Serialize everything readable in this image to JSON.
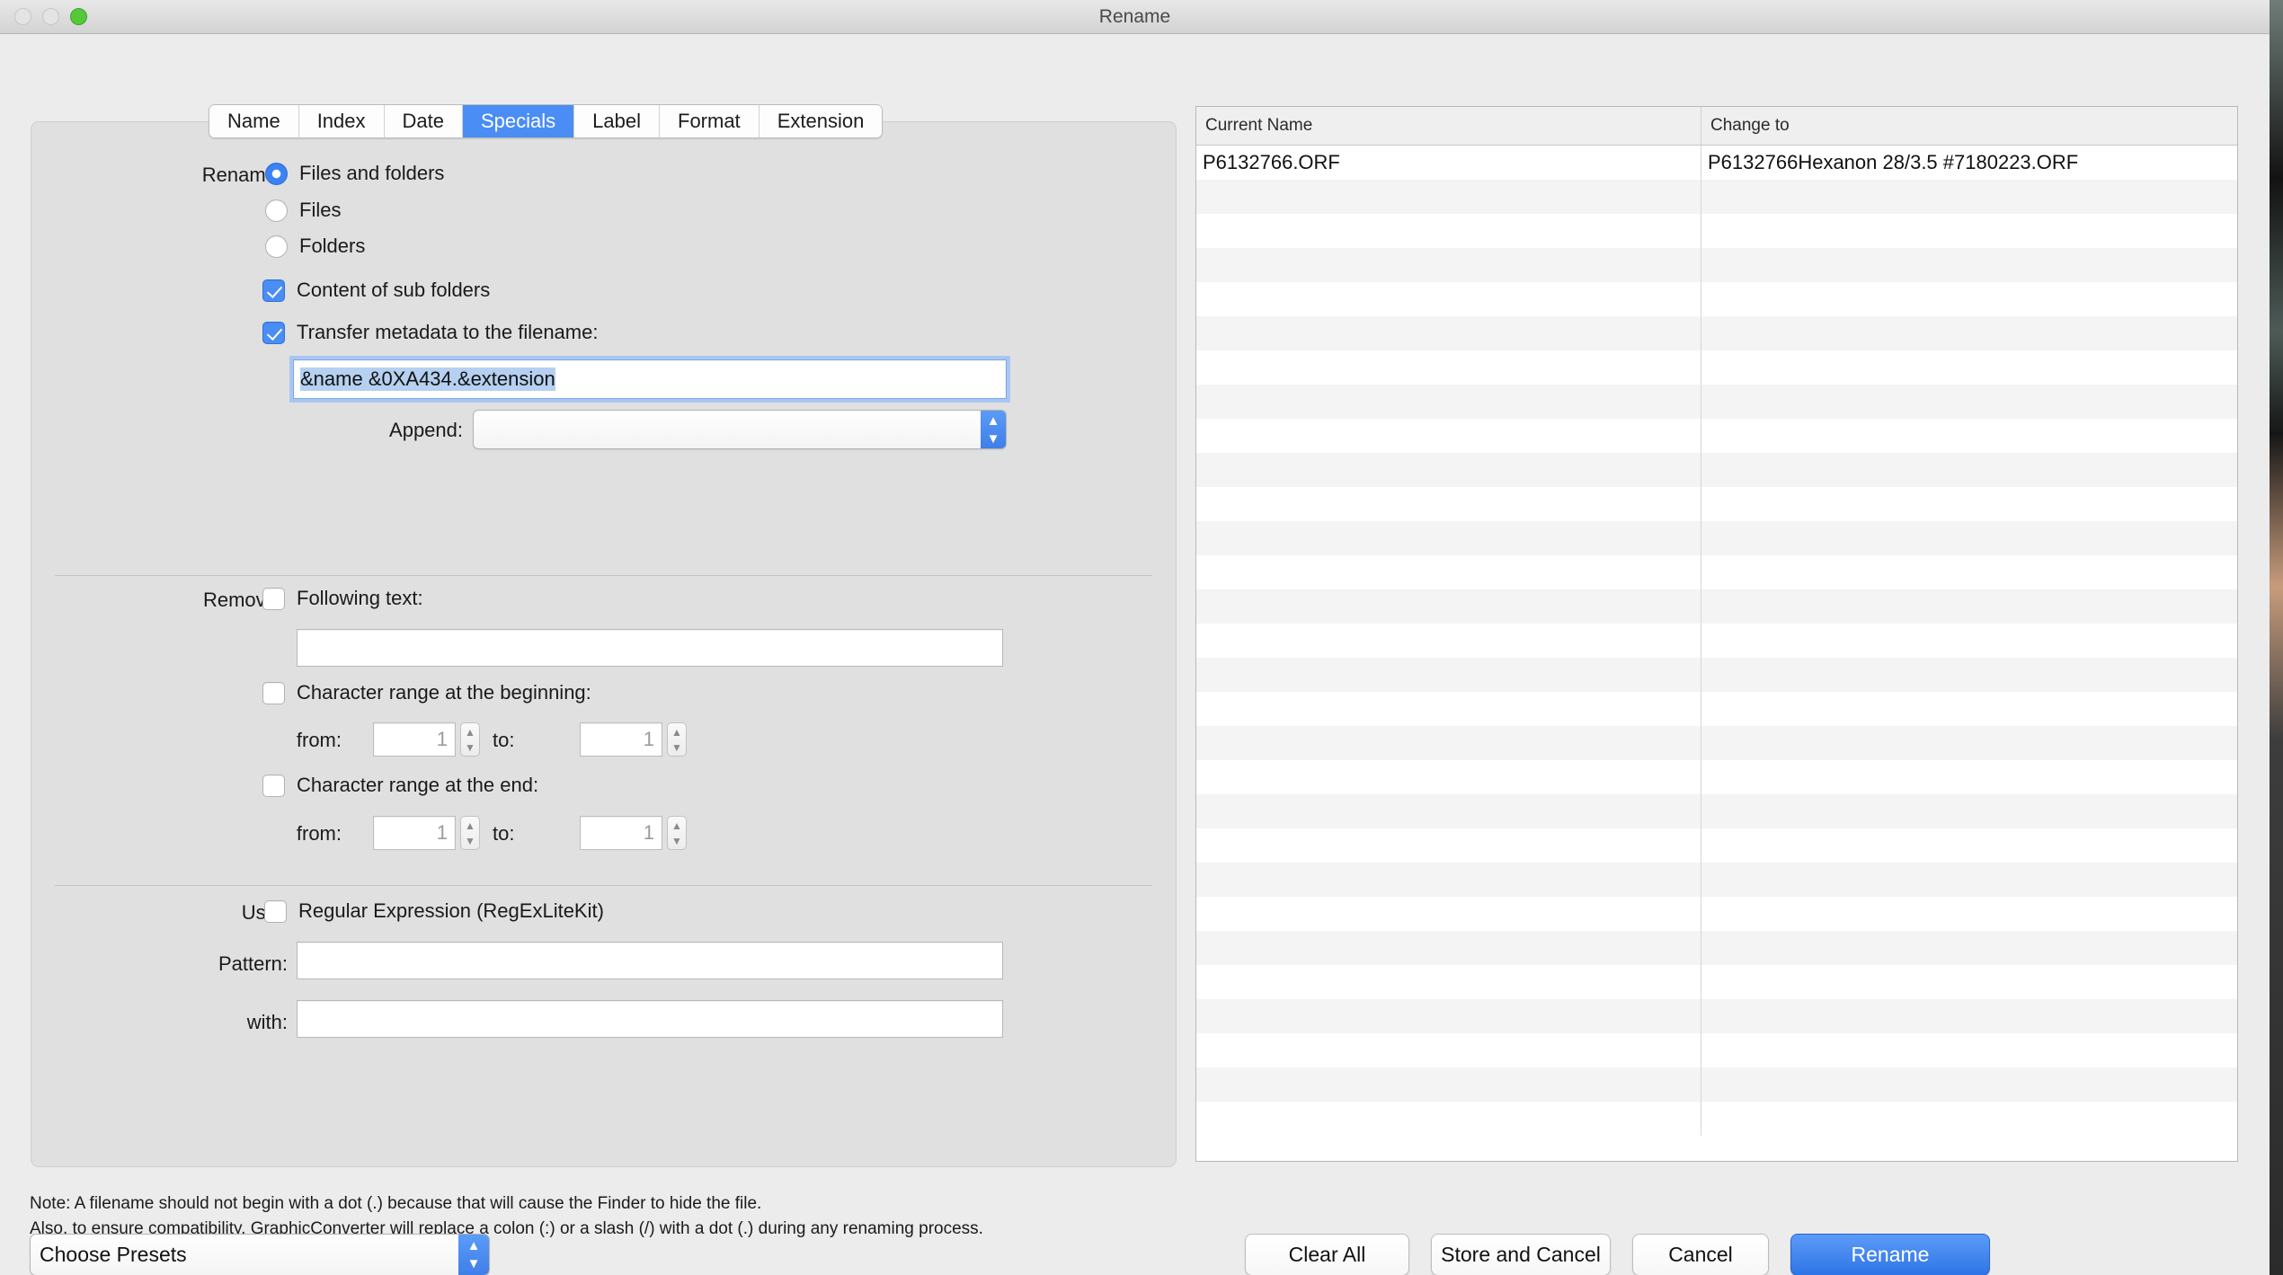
{
  "window": {
    "title": "Rename",
    "traffic_lights": [
      "close-disabled",
      "minimize-disabled",
      "zoom-green"
    ]
  },
  "tabs": [
    {
      "label": "Name",
      "active": false
    },
    {
      "label": "Index",
      "active": false
    },
    {
      "label": "Date",
      "active": false
    },
    {
      "label": "Specials",
      "active": true
    },
    {
      "label": "Label",
      "active": false
    },
    {
      "label": "Format",
      "active": false
    },
    {
      "label": "Extension",
      "active": false
    }
  ],
  "rename_section": {
    "label": "Rename:",
    "radios": [
      {
        "label": "Files and folders",
        "checked": true
      },
      {
        "label": "Files",
        "checked": false
      },
      {
        "label": "Folders",
        "checked": false
      }
    ],
    "checkboxes": [
      {
        "label": "Content of sub folders",
        "checked": true
      },
      {
        "label": "Transfer metadata to the filename:",
        "checked": true
      }
    ],
    "metadata_field": {
      "value": "&name &0XA434.&extension",
      "selected": true,
      "focused": true
    },
    "append": {
      "label": "Append:",
      "value": "",
      "placeholder": ""
    }
  },
  "remove_section": {
    "label": "Remove:",
    "following_text": {
      "label": "Following text:",
      "checked": false,
      "value": ""
    },
    "range_beginning": {
      "label": "Character range at the beginning:",
      "checked": false,
      "from_label": "from:",
      "from_value": "1",
      "to_label": "to:",
      "to_value": "1"
    },
    "range_end": {
      "label": "Character range at the end:",
      "checked": false,
      "from_label": "from:",
      "from_value": "1",
      "to_label": "to:",
      "to_value": "1"
    }
  },
  "use_section": {
    "label": "Use:",
    "regex": {
      "label": "Regular Expression (RegExLiteKit)",
      "checked": false
    },
    "pattern": {
      "label": "Pattern:",
      "value": ""
    },
    "with": {
      "label": "with:",
      "value": ""
    }
  },
  "table": {
    "headers": [
      "Current Name",
      "Change to"
    ],
    "rows": [
      {
        "current": "P6132766.ORF",
        "changed": "P6132766Hexanon 28/3.5 #7180223.ORF"
      },
      {
        "current": "",
        "changed": ""
      },
      {
        "current": "",
        "changed": ""
      },
      {
        "current": "",
        "changed": ""
      },
      {
        "current": "",
        "changed": ""
      },
      {
        "current": "",
        "changed": ""
      },
      {
        "current": "",
        "changed": ""
      },
      {
        "current": "",
        "changed": ""
      },
      {
        "current": "",
        "changed": ""
      },
      {
        "current": "",
        "changed": ""
      },
      {
        "current": "",
        "changed": ""
      },
      {
        "current": "",
        "changed": ""
      },
      {
        "current": "",
        "changed": ""
      },
      {
        "current": "",
        "changed": ""
      },
      {
        "current": "",
        "changed": ""
      },
      {
        "current": "",
        "changed": ""
      },
      {
        "current": "",
        "changed": ""
      },
      {
        "current": "",
        "changed": ""
      },
      {
        "current": "",
        "changed": ""
      },
      {
        "current": "",
        "changed": ""
      },
      {
        "current": "",
        "changed": ""
      },
      {
        "current": "",
        "changed": ""
      },
      {
        "current": "",
        "changed": ""
      },
      {
        "current": "",
        "changed": ""
      },
      {
        "current": "",
        "changed": ""
      },
      {
        "current": "",
        "changed": ""
      },
      {
        "current": "",
        "changed": ""
      },
      {
        "current": "",
        "changed": ""
      },
      {
        "current": "",
        "changed": ""
      }
    ]
  },
  "note": {
    "line1": "Note: A filename should not begin with a dot (.) because that will cause the Finder to hide the file.",
    "line2": "Also, to ensure compatibility, GraphicConverter will replace a colon (:) or a slash (/) with a dot (.) during any renaming process."
  },
  "presets": {
    "label": "Choose Presets"
  },
  "buttons": [
    {
      "label": "Clear All",
      "primary": false
    },
    {
      "label": "Store and Cancel",
      "primary": false
    },
    {
      "label": "Cancel",
      "primary": false
    },
    {
      "label": "Rename",
      "primary": true
    }
  ],
  "colors": {
    "accent_blue": "#4a8df5",
    "primary_button": "#2f74e6",
    "selection": "#b5d0f0",
    "window_bg": "#ececec",
    "panel_bg": "#e0e0e0",
    "row_alt": "#f4f4f4"
  }
}
